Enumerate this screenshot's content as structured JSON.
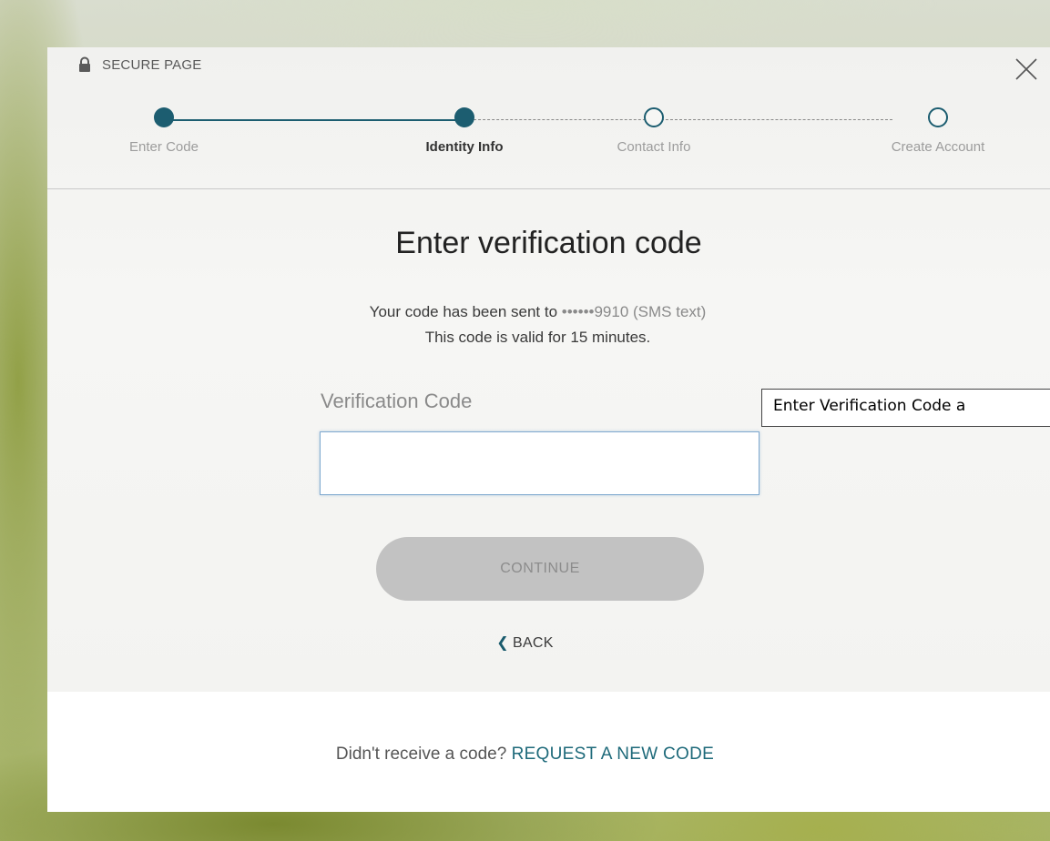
{
  "top_bar": {
    "secure_label": "SECURE PAGE",
    "lock_icon": "lock-icon",
    "close_icon": "close-icon"
  },
  "stepper": {
    "steps": [
      {
        "label": "Enter Code",
        "state": "completed"
      },
      {
        "label": "Identity Info",
        "state": "current"
      },
      {
        "label": "Contact Info",
        "state": "pending"
      },
      {
        "label": "Create Account",
        "state": "pending"
      }
    ],
    "accent_color": "#1c5d70"
  },
  "main": {
    "heading": "Enter verification code",
    "sent_prefix": "Your code has been sent to ",
    "sent_number": "••••••9910 (SMS text)",
    "validity": "This code is valid for 15 minutes.",
    "field_label": "Verification Code",
    "input_value": "",
    "continue_label": "CONTINUE",
    "back_label": "BACK"
  },
  "footer": {
    "prompt": "Didn't receive a code? ",
    "link_label": "REQUEST A NEW CODE"
  },
  "callout": {
    "text": "Enter Verification Code a"
  }
}
